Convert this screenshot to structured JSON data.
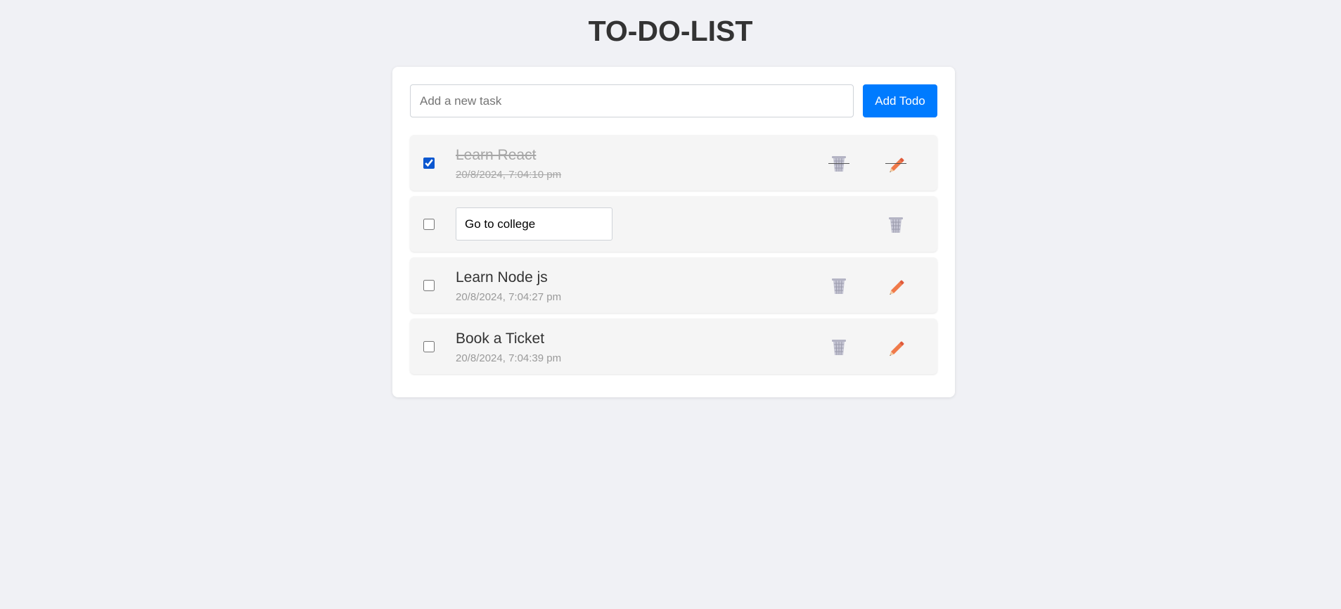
{
  "page": {
    "title": "TO-DO-LIST"
  },
  "add_form": {
    "placeholder": "Add a new task",
    "value": "",
    "button_label": "Add Todo"
  },
  "todos": [
    {
      "title": "Learn React",
      "timestamp": "20/8/2024, 7:04:10 pm",
      "completed": true,
      "editing": false
    },
    {
      "title": "Go to college",
      "timestamp": "",
      "completed": false,
      "editing": true,
      "edit_value": "Go to college"
    },
    {
      "title": "Learn Node js",
      "timestamp": "20/8/2024, 7:04:27 pm",
      "completed": false,
      "editing": false
    },
    {
      "title": "Book a Ticket",
      "timestamp": "20/8/2024, 7:04:39 pm",
      "completed": false,
      "editing": false
    }
  ],
  "icons": {
    "delete": "wastebasket-icon",
    "edit": "pencil-icon"
  },
  "colors": {
    "background": "#f0f1f5",
    "card": "#ffffff",
    "accent": "#007bff",
    "item_background": "#f5f5f5",
    "pencil": "#f07a4a",
    "bin": "#b9b9c8"
  }
}
